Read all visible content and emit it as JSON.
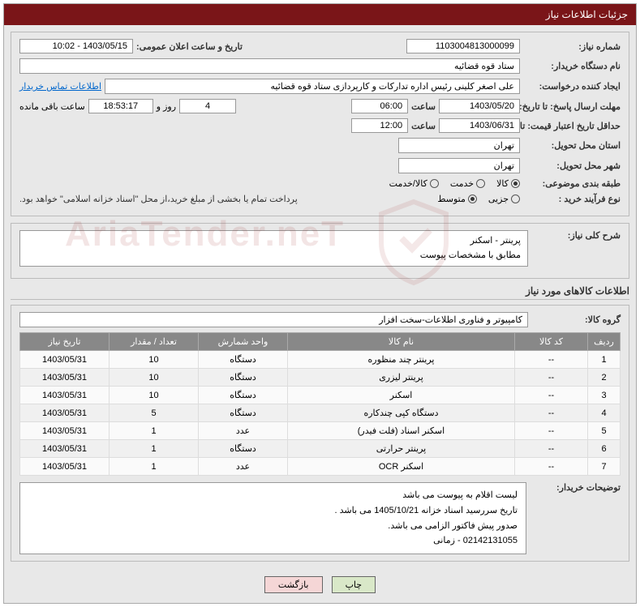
{
  "title": "جزئیات اطلاعات نیاز",
  "fields": {
    "need_no_label": "شماره نیاز:",
    "need_no": "1103004813000099",
    "announce_label": "تاریخ و ساعت اعلان عمومی:",
    "announce": "1403/05/15 - 10:02",
    "buyer_org_label": "نام دستگاه خریدار:",
    "buyer_org": "ستاد قوه قضائیه",
    "requester_label": "ایجاد کننده درخواست:",
    "requester": "علی اصغر کلینی رئیس اداره تدارکات و کارپردازی ستاد قوه قضائیه",
    "contact_link": "اطلاعات تماس خریدار",
    "deadline_label": "مهلت ارسال پاسخ: تا تاریخ:",
    "deadline_date": "1403/05/20",
    "time_label": "ساعت",
    "deadline_time": "06:00",
    "days_remaining": "4",
    "days_text": "روز و",
    "time_remaining": "18:53:17",
    "remaining_text": "ساعت باقی مانده",
    "validity_label": "حداقل تاریخ اعتبار قیمت: تا تاریخ:",
    "validity_date": "1403/06/31",
    "validity_time": "12:00",
    "province_label": "استان محل تحویل:",
    "province": "تهران",
    "city_label": "شهر محل تحویل:",
    "city": "تهران",
    "category_label": "طبقه بندی موضوعی:",
    "cat_goods": "کالا",
    "cat_service": "خدمت",
    "cat_both": "کالا/خدمت",
    "process_label": "نوع فرآیند خرید :",
    "proc_small": "جزیی",
    "proc_medium": "متوسط",
    "payment_note": "پرداخت تمام یا بخشی از مبلغ خرید،از محل \"اسناد خزانه اسلامی\" خواهد بود.",
    "summary_label": "شرح کلی نیاز:",
    "summary_line1": "پرینتر - اسکنر",
    "summary_line2": "مطابق با مشخصات پیوست",
    "goods_section": "اطلاعات کالاهای مورد نیاز",
    "group_label": "گروه کالا:",
    "group": "کامپیوتر و فناوری اطلاعات-سخت افزار",
    "notes_label": "توضیحات خریدار:",
    "notes_l1": "لیست اقلام به پیوست می باشد",
    "notes_l2": "تاریخ سررسید اسناد خزانه 1405/10/21 می باشد .",
    "notes_l3": "صدور پیش فاکتور الزامی می باشد.",
    "notes_l4": "02142131055 - زمانی"
  },
  "table": {
    "headers": [
      "ردیف",
      "کد کالا",
      "نام کالا",
      "واحد شمارش",
      "تعداد / مقدار",
      "تاریخ نیاز"
    ],
    "rows": [
      {
        "n": "1",
        "code": "--",
        "name": "پرینتر چند منظوره",
        "unit": "دستگاه",
        "qty": "10",
        "date": "1403/05/31"
      },
      {
        "n": "2",
        "code": "--",
        "name": "پرینتر لیزری",
        "unit": "دستگاه",
        "qty": "10",
        "date": "1403/05/31"
      },
      {
        "n": "3",
        "code": "--",
        "name": "اسکنر",
        "unit": "دستگاه",
        "qty": "10",
        "date": "1403/05/31"
      },
      {
        "n": "4",
        "code": "--",
        "name": "دستگاه کپی چندکاره",
        "unit": "دستگاه",
        "qty": "5",
        "date": "1403/05/31"
      },
      {
        "n": "5",
        "code": "--",
        "name": "اسکنر اسناد (فلت فیدر)",
        "unit": "عدد",
        "qty": "1",
        "date": "1403/05/31"
      },
      {
        "n": "6",
        "code": "--",
        "name": "پرینتر حرارتی",
        "unit": "دستگاه",
        "qty": "1",
        "date": "1403/05/31"
      },
      {
        "n": "7",
        "code": "--",
        "name": "اسکنر OCR",
        "unit": "عدد",
        "qty": "1",
        "date": "1403/05/31"
      }
    ]
  },
  "buttons": {
    "print": "چاپ",
    "back": "بازگشت"
  },
  "watermark": "AriaTender.neT"
}
